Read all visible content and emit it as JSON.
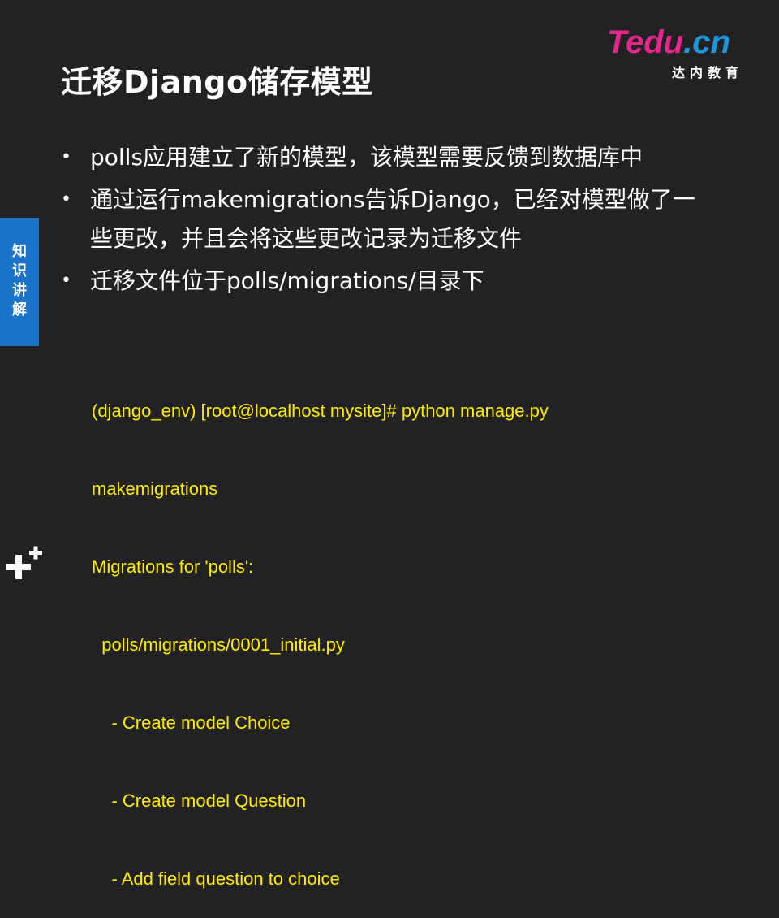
{
  "slide": {
    "title": "迁移Django储存模型",
    "brand": {
      "mark_t": "T",
      "mark_rest": "edu",
      "mark_cn": ".cn",
      "subtitle": "达内教育"
    },
    "side_tab": "知识讲解",
    "bullets": [
      "polls应用建立了新的模型，该模型需要反馈到数据库中",
      "通过运行makemigrations告诉Django，已经对模型做了一些更改，并且会将这些更改记录为迁移文件",
      "迁移文件位于polls/migrations/目录下"
    ],
    "code_lines": [
      "(django_env) [root@localhost mysite]# python manage.py",
      "makemigrations",
      "Migrations for 'polls':",
      "  polls/migrations/0001_initial.py",
      "    - Create model Choice",
      "    - Create model Question",
      "    - Add field question to choice"
    ]
  },
  "colors": {
    "background": "#222222",
    "accent_pink": "#e6268c",
    "accent_blue": "#1e96dc",
    "code": "#ffeb00",
    "tab": "#1a73c8"
  }
}
